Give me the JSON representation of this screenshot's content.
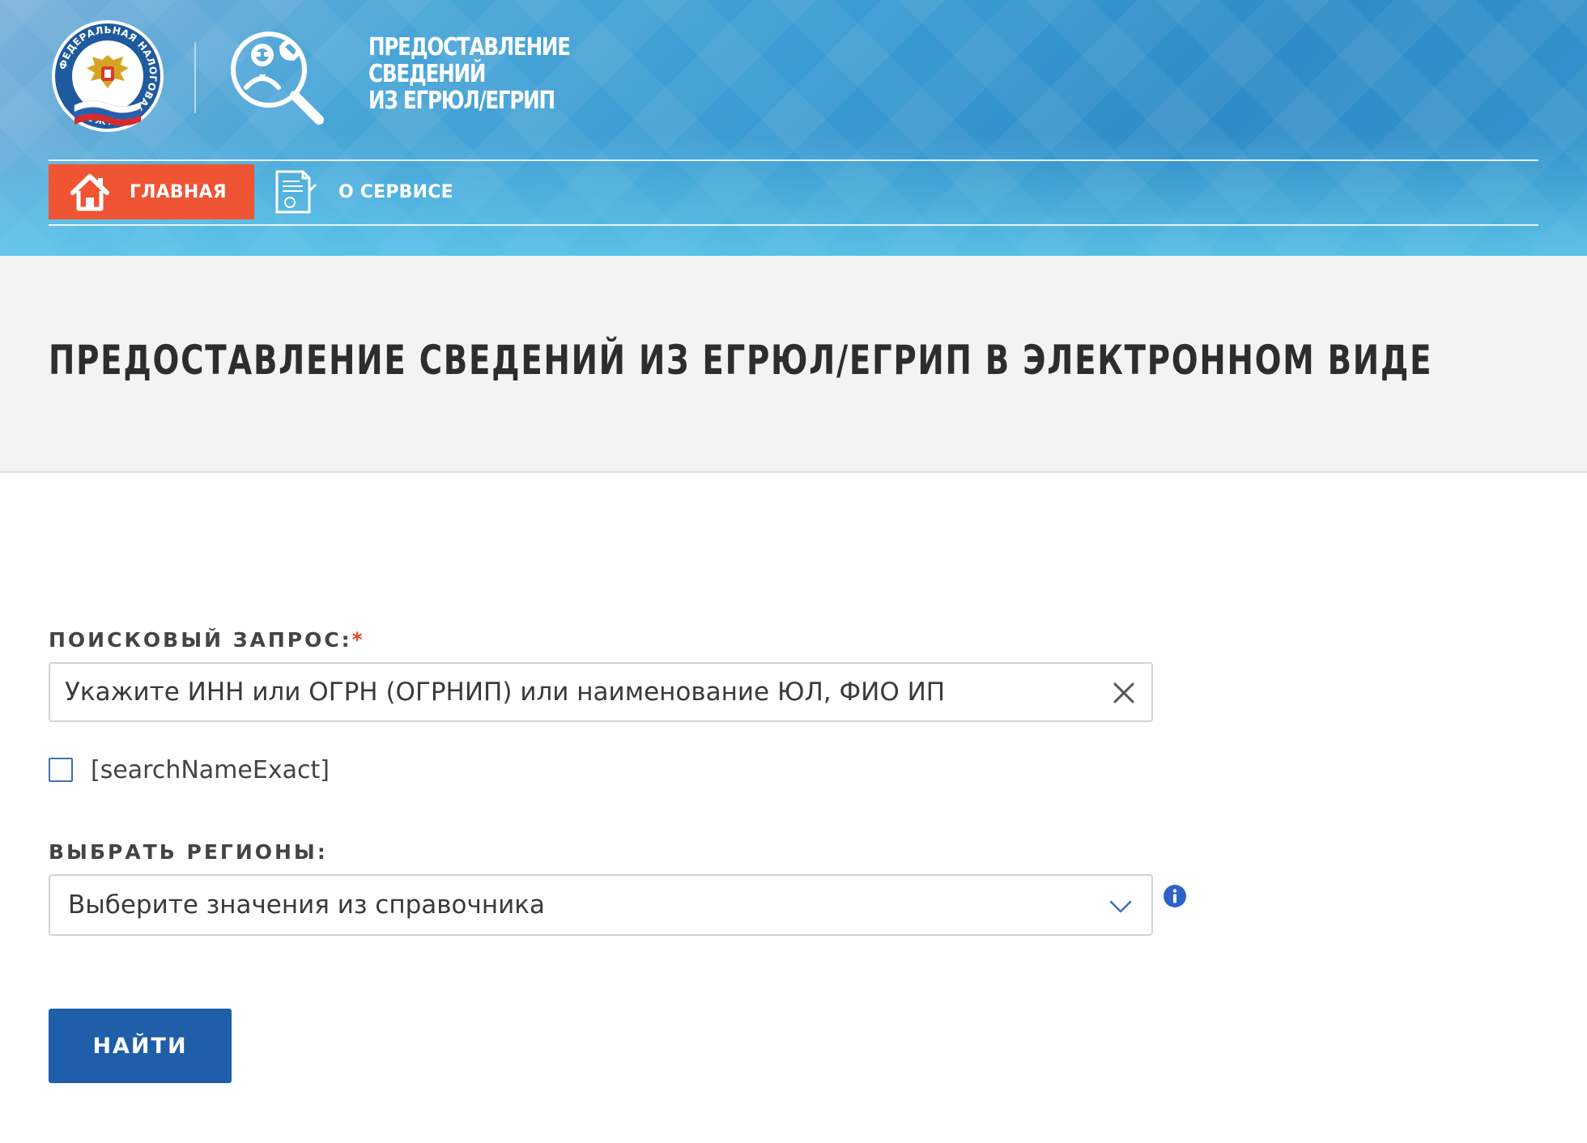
{
  "header": {
    "emblem": {
      "icon": "fns-emblem-icon",
      "text": "ФЕДЕРАЛЬНАЯ НАЛОГОВАЯ СЛУЖБА"
    },
    "service_icon": "person-magnifier-wrench-icon",
    "service_title": [
      "ПРЕДОСТАВЛЕНИЕ",
      "СВЕДЕНИЙ",
      "ИЗ ЕГРЮЛ/ЕГРИП"
    ]
  },
  "nav": {
    "items": [
      {
        "label": "ГЛАВНАЯ",
        "icon": "home-icon",
        "active": true
      },
      {
        "label": "О СЕРВИСЕ",
        "icon": "document-icon",
        "active": false
      }
    ]
  },
  "page": {
    "title": "ПРЕДОСТАВЛЕНИЕ СВЕДЕНИЙ ИЗ ЕГРЮЛ/ЕГРИП В ЭЛЕКТРОННОМ ВИДЕ"
  },
  "form": {
    "query": {
      "label": "ПОИСКОВЫЙ ЗАПРОС:",
      "required_mark": "*",
      "placeholder": "Укажите ИНН или ОГРН (ОГРНИП) или наименование ЮЛ, ФИО ИП",
      "value": ""
    },
    "exact_checkbox": {
      "label": "[searchNameExact]",
      "checked": false
    },
    "regions": {
      "label": "ВЫБРАТЬ РЕГИОНЫ:",
      "placeholder": "Выберите значения из справочника"
    },
    "submit_label": "НАЙТИ"
  },
  "colors": {
    "accent_orange": "#ef5433",
    "button_blue": "#1f5ea8",
    "header_blue": "#3a9bd2",
    "required_red": "#e8432b",
    "info_blue": "#2d63c8"
  }
}
